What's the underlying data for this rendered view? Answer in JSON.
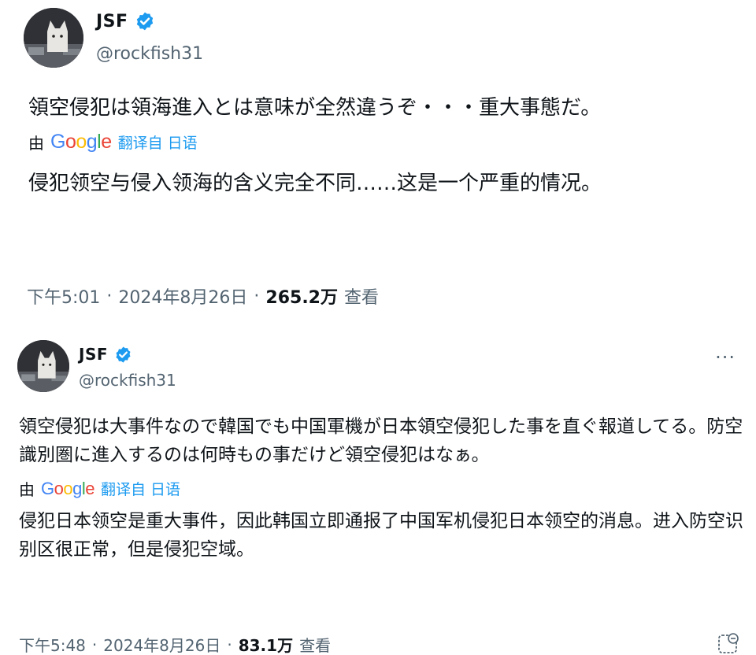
{
  "tweets": [
    {
      "author_name": "JSF",
      "handle": "@rockfish31",
      "original_text": "領空侵犯は領海進入とは意味が全然違うぞ・・・重大事態だ。",
      "translation_by": "由",
      "translation_provider": "Google",
      "translated_from": "翻译自 日语",
      "translated_text": "侵犯领空与侵入领海的含义完全不同……这是一个严重的情况。",
      "time": "下午5:01",
      "separator": "·",
      "date": "2024年8月26日",
      "views_count": "265.2万",
      "views_label": "查看"
    },
    {
      "author_name": "JSF",
      "handle": "@rockfish31",
      "more_menu": "···",
      "original_text": "領空侵犯は大事件なので韓国でも中国軍機が日本領空侵犯した事を直ぐ報道してる。防空識別圏に進入するのは何時もの事だけど領空侵犯はなぁ。",
      "translation_by": "由",
      "translation_provider": "Google",
      "translated_from": "翻译自 日语",
      "translated_text": "侵犯日本领空是重大事件，因此韩国立即通报了中国军机侵犯日本领空的消息。进入防空识别区很正常，但是侵犯空域。",
      "time": "下午5:48",
      "separator": "·",
      "date": "2024年8月26日",
      "views_count": "83.1万",
      "views_label": "查看"
    }
  ],
  "colors": {
    "verified_badge": "#1d9bf0",
    "link_blue": "#1d9bf0",
    "secondary_text": "#536471",
    "primary_text": "#0f1419"
  },
  "icons": {
    "verified": "verified-badge-icon",
    "more": "more-options-icon",
    "grok": "grok-icon"
  }
}
